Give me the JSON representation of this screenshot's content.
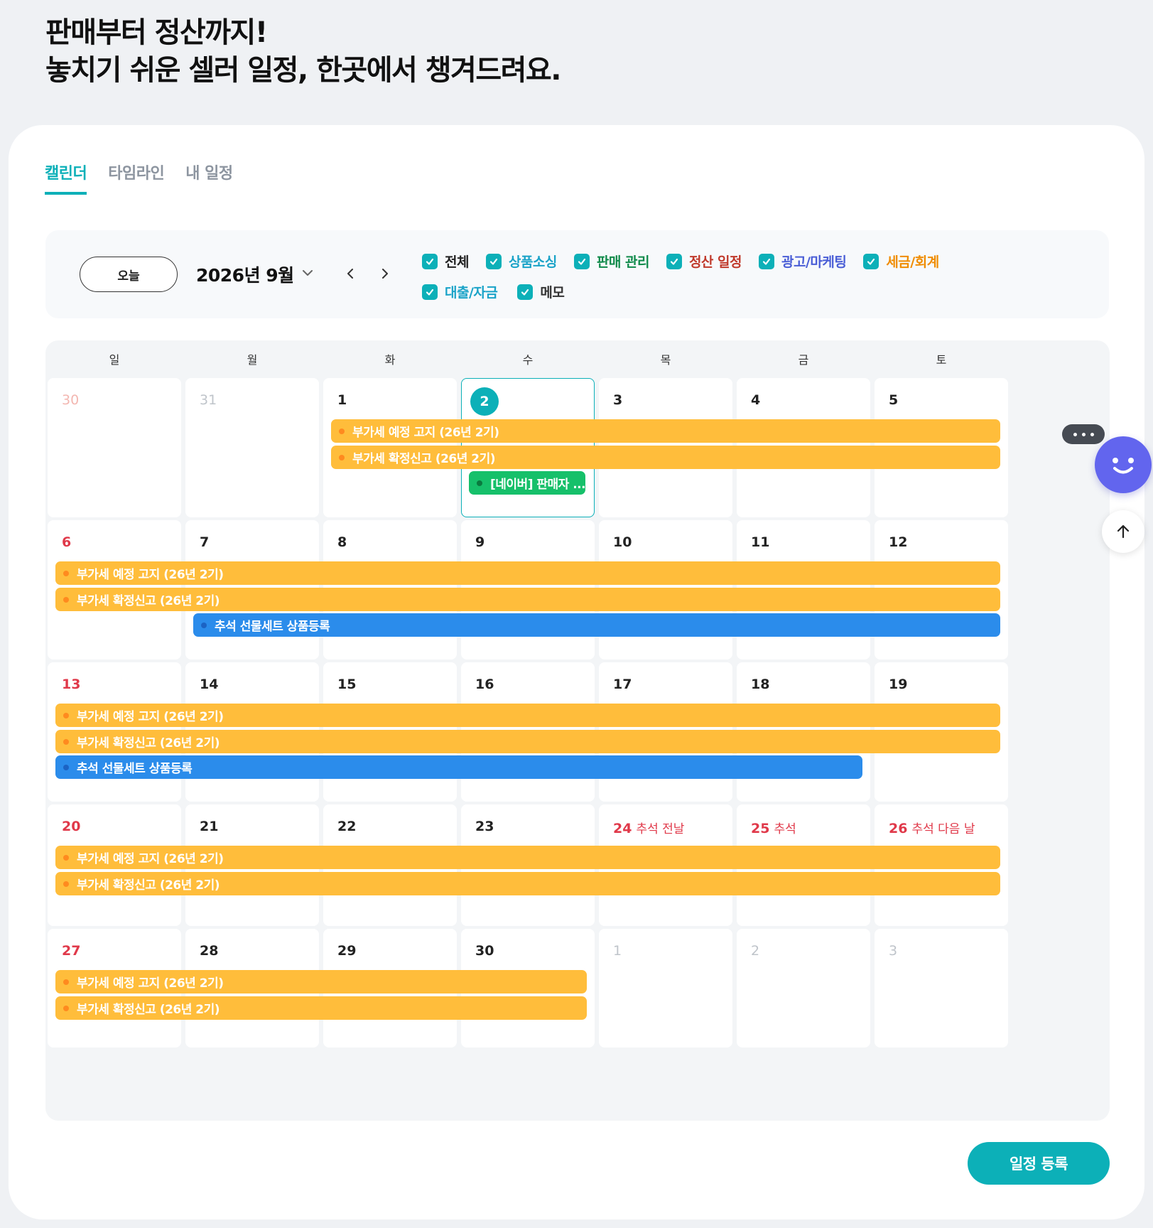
{
  "headline": {
    "line1": "판매부터 정산까지!",
    "line2": "놓치기 쉬운 셀러 일정, 한곳에서 챙겨드려요."
  },
  "tabs": [
    {
      "label": "캘린더",
      "active": true
    },
    {
      "label": "타임라인",
      "active": false
    },
    {
      "label": "내 일정",
      "active": false
    }
  ],
  "toolbar": {
    "today_label": "오늘",
    "month_label": "2026년 9월"
  },
  "filters": [
    {
      "label": "전체",
      "color": "#222222",
      "checked": true
    },
    {
      "label": "상품소싱",
      "color": "#1aa3c8",
      "checked": true
    },
    {
      "label": "판매 관리",
      "color": "#0f8a4a",
      "checked": true
    },
    {
      "label": "정산 일정",
      "color": "#c0392b",
      "checked": true
    },
    {
      "label": "광고/마케팅",
      "color": "#4a5ed6",
      "checked": true
    },
    {
      "label": "세금/회계",
      "color": "#f08c00",
      "checked": true
    },
    {
      "label": "대출/자금",
      "color": "#1aa3c8",
      "checked": true
    },
    {
      "label": "메모",
      "color": "#333333",
      "checked": true
    }
  ],
  "weekdays": [
    "일",
    "월",
    "화",
    "수",
    "목",
    "금",
    "토"
  ],
  "weeks": [
    [
      {
        "n": "30",
        "kind": "dimsun"
      },
      {
        "n": "31",
        "kind": "dim"
      },
      {
        "n": "1"
      },
      {
        "n": "2",
        "today": true
      },
      {
        "n": "3"
      },
      {
        "n": "4"
      },
      {
        "n": "5"
      }
    ],
    [
      {
        "n": "6",
        "kind": "sun"
      },
      {
        "n": "7"
      },
      {
        "n": "8"
      },
      {
        "n": "9"
      },
      {
        "n": "10"
      },
      {
        "n": "11"
      },
      {
        "n": "12"
      }
    ],
    [
      {
        "n": "13",
        "kind": "sun"
      },
      {
        "n": "14"
      },
      {
        "n": "15"
      },
      {
        "n": "16"
      },
      {
        "n": "17"
      },
      {
        "n": "18"
      },
      {
        "n": "19"
      }
    ],
    [
      {
        "n": "20",
        "kind": "sun"
      },
      {
        "n": "21"
      },
      {
        "n": "22"
      },
      {
        "n": "23"
      },
      {
        "n": "24",
        "kind": "sun",
        "holiday": "추석 전날"
      },
      {
        "n": "25",
        "kind": "sun",
        "holiday": "추석"
      },
      {
        "n": "26",
        "kind": "sun",
        "holiday": "추석 다음 날"
      }
    ],
    [
      {
        "n": "27",
        "kind": "sun"
      },
      {
        "n": "28"
      },
      {
        "n": "29"
      },
      {
        "n": "30"
      },
      {
        "n": "1",
        "kind": "dim"
      },
      {
        "n": "2",
        "kind": "dim"
      },
      {
        "n": "3",
        "kind": "dim"
      }
    ]
  ],
  "events": [
    {
      "week": 0,
      "slot": 0,
      "start": 2,
      "end": 6,
      "label": "부가세 예정 고지 (26년 2기)",
      "color": "y"
    },
    {
      "week": 0,
      "slot": 1,
      "start": 2,
      "end": 6,
      "label": "부가세 확정신고 (26년 2기)",
      "color": "y"
    },
    {
      "week": 0,
      "slot": 2,
      "start": 3,
      "end": 3,
      "label": "[네이버] 판매자 ...",
      "color": "g"
    },
    {
      "week": 1,
      "slot": 0,
      "start": 0,
      "end": 6,
      "label": "부가세 예정 고지 (26년 2기)",
      "color": "y"
    },
    {
      "week": 1,
      "slot": 1,
      "start": 0,
      "end": 6,
      "label": "부가세 확정신고 (26년 2기)",
      "color": "y"
    },
    {
      "week": 1,
      "slot": 2,
      "start": 1,
      "end": 6,
      "label": "추석 선물세트 상품등록",
      "color": "b"
    },
    {
      "week": 2,
      "slot": 0,
      "start": 0,
      "end": 6,
      "label": "부가세 예정 고지 (26년 2기)",
      "color": "y"
    },
    {
      "week": 2,
      "slot": 1,
      "start": 0,
      "end": 6,
      "label": "부가세 확정신고 (26년 2기)",
      "color": "y"
    },
    {
      "week": 2,
      "slot": 2,
      "start": 0,
      "end": 5,
      "label": "추석 선물세트 상품등록",
      "color": "b"
    },
    {
      "week": 3,
      "slot": 0,
      "start": 0,
      "end": 6,
      "label": "부가세 예정 고지 (26년 2기)",
      "color": "y"
    },
    {
      "week": 3,
      "slot": 1,
      "start": 0,
      "end": 6,
      "label": "부가세 확정신고 (26년 2기)",
      "color": "y"
    },
    {
      "week": 4,
      "slot": 0,
      "start": 0,
      "end": 3,
      "label": "부가세 예정 고지 (26년 2기)",
      "color": "y"
    },
    {
      "week": 4,
      "slot": 1,
      "start": 0,
      "end": 3,
      "label": "부가세 확정신고 (26년 2기)",
      "color": "y"
    }
  ],
  "register_label": "일정 등록",
  "colors": {
    "accent": "#0cb0b8",
    "event_yellow": "#ffbd3b",
    "event_blue": "#2b8ceb",
    "event_green": "#16c06a",
    "sunday_red": "#e0394a"
  }
}
